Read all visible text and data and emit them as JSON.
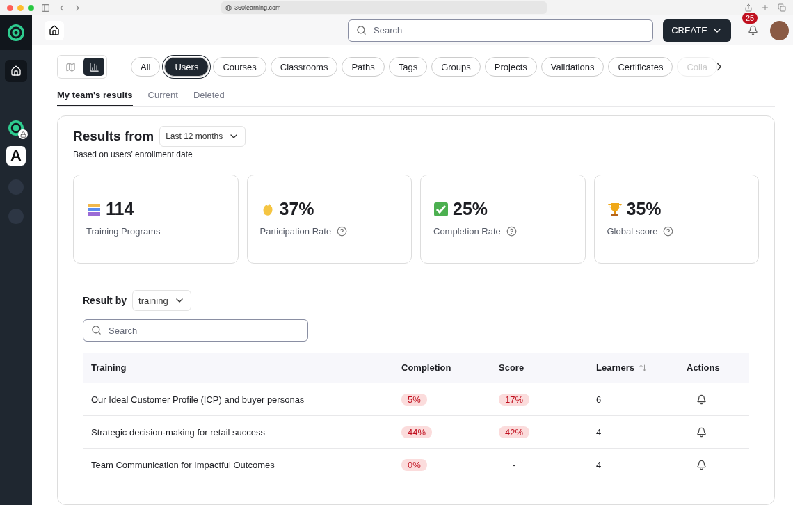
{
  "browser": {
    "url": "360learning.com"
  },
  "sidebar": {
    "items": [
      {
        "kind": "home",
        "selected": true
      },
      {
        "kind": "locked-logo",
        "selected": false
      },
      {
        "kind": "letter",
        "label": "A",
        "selected": false
      },
      {
        "kind": "dot",
        "selected": false
      },
      {
        "kind": "dot",
        "selected": false
      }
    ]
  },
  "header": {
    "search": {
      "placeholder": "Search"
    },
    "create_button": "CREATE",
    "notifications": "25"
  },
  "view_toggle": [
    {
      "kind": "map",
      "selected": false
    },
    {
      "kind": "chart",
      "selected": true
    }
  ],
  "filters": [
    {
      "label": "All",
      "selected": false
    },
    {
      "label": "Users",
      "selected": true
    },
    {
      "label": "Courses",
      "selected": false
    },
    {
      "label": "Classrooms",
      "selected": false
    },
    {
      "label": "Paths",
      "selected": false
    },
    {
      "label": "Tags",
      "selected": false
    },
    {
      "label": "Groups",
      "selected": false
    },
    {
      "label": "Projects",
      "selected": false
    },
    {
      "label": "Validations",
      "selected": false
    },
    {
      "label": "Certificates",
      "selected": false
    },
    {
      "label": "Colla",
      "selected": false
    }
  ],
  "tabs": [
    {
      "label": "My team's results",
      "selected": true
    },
    {
      "label": "Current",
      "selected": false
    },
    {
      "label": "Deleted",
      "selected": false
    }
  ],
  "results": {
    "title": "Results from",
    "period": "Last 12 months",
    "subtitle": "Based on users' enrollment date",
    "stats": [
      {
        "kind": "books",
        "value": "114",
        "label": "Training Programs",
        "help": false
      },
      {
        "kind": "wave",
        "value": "37%",
        "label": "Participation Rate",
        "help": true
      },
      {
        "kind": "check",
        "value": "25%",
        "label": "Completion Rate",
        "help": true
      },
      {
        "kind": "trophy",
        "value": "35%",
        "label": "Global score",
        "help": true
      }
    ],
    "result_by": {
      "label": "Result by",
      "value": "training"
    },
    "search": {
      "placeholder": "Search"
    },
    "table": {
      "columns": [
        "Training",
        "Completion",
        "Score",
        "Learners",
        "Actions"
      ],
      "rows": [
        {
          "training": "Our Ideal Customer Profile (ICP) and buyer personas",
          "completion": "5%",
          "score": "17%",
          "learners": "6"
        },
        {
          "training": "Strategic decision-making for retail success",
          "completion": "44%",
          "score": "42%",
          "learners": "4"
        },
        {
          "training": "Team Communication for Impactful Outcomes",
          "completion": "0%",
          "score": "-",
          "learners": "4"
        }
      ]
    }
  }
}
